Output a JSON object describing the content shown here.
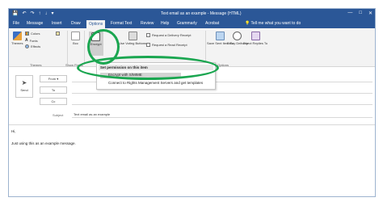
{
  "titlebar": {
    "title": "Text email as an example  -  Message (HTML)",
    "qat_icons": [
      "save-icon",
      "undo-icon",
      "redo-icon",
      "up-icon",
      "down-icon",
      "customize-icon"
    ],
    "window_controls": [
      "—",
      "□",
      "✕"
    ]
  },
  "tabs": [
    {
      "label": "File"
    },
    {
      "label": "Message"
    },
    {
      "label": "Insert"
    },
    {
      "label": "Draw"
    },
    {
      "label": "Options"
    },
    {
      "label": "Format Text"
    },
    {
      "label": "Review"
    },
    {
      "label": "Help"
    },
    {
      "label": "Grammarly"
    },
    {
      "label": "Acrobat"
    }
  ],
  "active_tab": "Options",
  "tell_me": "Tell me what you want to do",
  "ribbon": {
    "themes_label": "Themes",
    "colors_label": "Colors",
    "fonts_label": "Fonts",
    "effects_label": "Effects",
    "group_themes": "Themes",
    "bcc_label": "Bcc",
    "group_show_fields": "Show Fields",
    "encrypt_label": "Encrypt",
    "use_voting_label": "Use Voting Buttons",
    "delivery_receipt": "Request a Delivery Receipt",
    "read_receipt": "Request a Read Receipt",
    "save_sent_label": "Save Sent Item To",
    "delay_label": "Delay Delivery",
    "direct_label": "Direct Replies To",
    "group_more_options": "More Options"
  },
  "menu": {
    "header": "Set permission on this item",
    "item_selected": "Encrypt with S/MIME",
    "item_second": "Connect to Rights Management Servers and get templates"
  },
  "fields": {
    "send_label": "Send",
    "from_label": "From",
    "from_value": "",
    "to_label": "To",
    "to_value": "",
    "cc_label": "Cc",
    "subject_label": "Subject",
    "subject_value": "Text email as an example"
  },
  "body": {
    "greeting": "Hi,",
    "text": "Just using this as an example message."
  },
  "colors": {
    "titlebar": "#2b5797",
    "annotation": "#1aa650"
  }
}
